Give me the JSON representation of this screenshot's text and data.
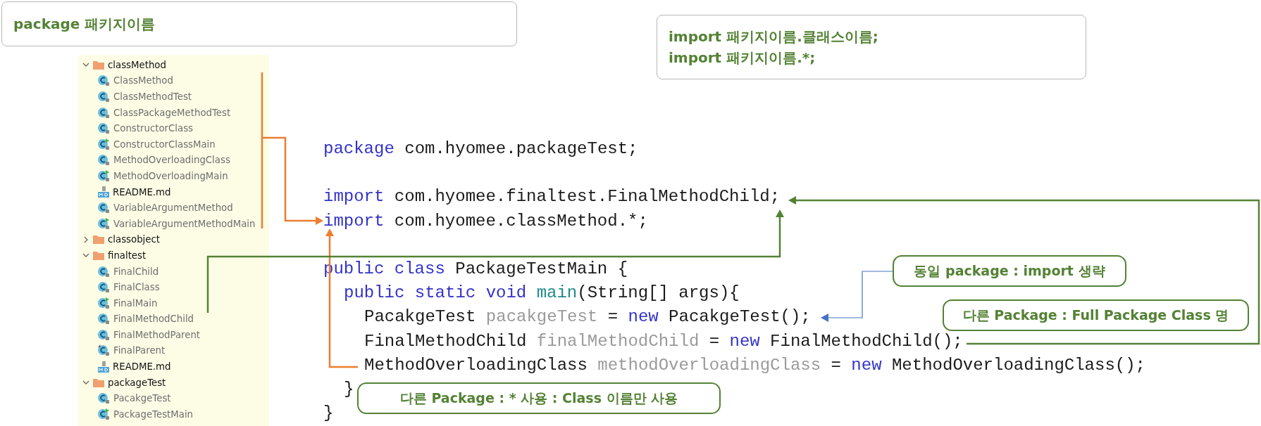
{
  "package_box": {
    "text": "package 패키지이름"
  },
  "import_box": {
    "lines": [
      "import 패키지이름.클래스이름;",
      "import 패키지이름.*;"
    ]
  },
  "project_tree": [
    {
      "name": "classMethod",
      "expanded": true,
      "children": [
        {
          "name": "ClassMethod",
          "kind": "class"
        },
        {
          "name": "ClassMethodTest",
          "kind": "class"
        },
        {
          "name": "ClassPackageMethodTest",
          "kind": "class"
        },
        {
          "name": "ConstructorClass",
          "kind": "class"
        },
        {
          "name": "ConstructorClassMain",
          "kind": "runnable"
        },
        {
          "name": "MethodOverloadingClass",
          "kind": "class"
        },
        {
          "name": "MethodOverloadingMain",
          "kind": "runnable"
        },
        {
          "name": "README.md",
          "kind": "markdown"
        },
        {
          "name": "VariableArgumentMethod",
          "kind": "class"
        },
        {
          "name": "VariableArgumentMethodMain",
          "kind": "runnable"
        }
      ]
    },
    {
      "name": "classobject",
      "expanded": false
    },
    {
      "name": "finaltest",
      "expanded": true,
      "children": [
        {
          "name": "FinalChild",
          "kind": "class"
        },
        {
          "name": "FinalClass",
          "kind": "class"
        },
        {
          "name": "FinalMain",
          "kind": "runnable"
        },
        {
          "name": "FinalMethodChild",
          "kind": "class"
        },
        {
          "name": "FinalMethodParent",
          "kind": "class"
        },
        {
          "name": "FinalParent",
          "kind": "parent"
        },
        {
          "name": "README.md",
          "kind": "markdown"
        }
      ]
    },
    {
      "name": "packageTest",
      "expanded": true,
      "children": [
        {
          "name": "PacakgeTest",
          "kind": "class"
        },
        {
          "name": "PackageTestMain",
          "kind": "runnable"
        }
      ]
    }
  ],
  "code_lines": [
    {
      "kind": "top",
      "tokens": [
        {
          "text": "package",
          "kind": "keyword"
        },
        {
          "text": " com.hyomee.packageTest;",
          "kind": "plain"
        }
      ]
    },
    {
      "kind": "blank"
    },
    {
      "kind": "top",
      "tokens": [
        {
          "text": "import",
          "kind": "keyword"
        },
        {
          "text": " com.hyomee.finaltest.FinalMethodChild;",
          "kind": "plain"
        }
      ]
    },
    {
      "kind": "top",
      "tokens": [
        {
          "text": "import",
          "kind": "keyword"
        },
        {
          "text": " com.hyomee.classMethod.*;",
          "kind": "plain"
        }
      ]
    },
    {
      "kind": "blank"
    },
    {
      "kind": "top",
      "tokens": [
        {
          "text": "public class",
          "kind": "keyword"
        },
        {
          "text": " PackageTestMain {",
          "kind": "plain"
        }
      ]
    },
    {
      "kind": "member",
      "tokens": [
        {
          "text": "public static void",
          "kind": "keyword"
        },
        {
          "text": " main",
          "kind": "method"
        },
        {
          "text": "(String[] args){",
          "kind": "plain"
        }
      ]
    },
    {
      "kind": "body",
      "tokens": [
        {
          "text": "PacakgeTest ",
          "kind": "plain"
        },
        {
          "text": "pacakgeTest",
          "kind": "variable"
        },
        {
          "text": " = ",
          "kind": "plain"
        },
        {
          "text": "new",
          "kind": "keyword"
        },
        {
          "text": " PacakgeTest();",
          "kind": "plain"
        }
      ]
    },
    {
      "kind": "body",
      "tokens": [
        {
          "text": "FinalMethodChild ",
          "kind": "plain"
        },
        {
          "text": "finalMethodChild",
          "kind": "variable"
        },
        {
          "text": " = ",
          "kind": "plain"
        },
        {
          "text": "new",
          "kind": "keyword"
        },
        {
          "text": " FinalMethodChild();",
          "kind": "plain"
        }
      ]
    },
    {
      "kind": "body",
      "tokens": [
        {
          "text": "MethodOverloadingClass ",
          "kind": "plain"
        },
        {
          "text": "methodOverloadingClass",
          "kind": "variable"
        },
        {
          "text": " = ",
          "kind": "plain"
        },
        {
          "text": "new",
          "kind": "keyword"
        },
        {
          "text": " MethodOverloadingClass();",
          "kind": "plain"
        }
      ]
    },
    {
      "kind": "member",
      "tokens": [
        {
          "text": "}",
          "kind": "plain"
        }
      ]
    },
    {
      "kind": "top",
      "tokens": [
        {
          "text": "}",
          "kind": "plain"
        }
      ]
    }
  ],
  "callouts": [
    {
      "text": "동일 package : import 생략",
      "kind": "same"
    },
    {
      "text": "다른 Package : Full Package Class 명",
      "kind": "full"
    },
    {
      "text": "다른 Package : * 사용 : Class 이름만 사용",
      "kind": "star"
    }
  ]
}
